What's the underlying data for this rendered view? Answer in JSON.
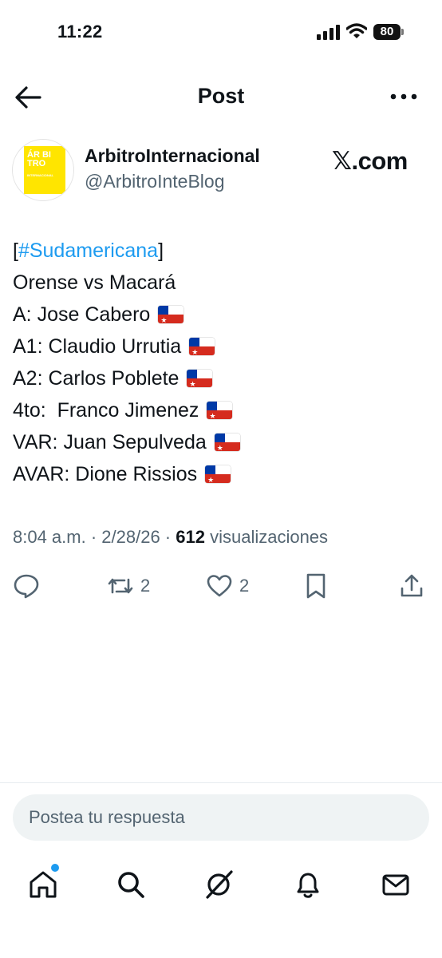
{
  "status_bar": {
    "time": "11:22",
    "battery": "80"
  },
  "header": {
    "title": "Post"
  },
  "author": {
    "display_name": "ArbitroInternacional",
    "handle": "@ArbitroInteBlog",
    "logo_text": "ÁR BI TRO",
    "logo_subtext": "INTERNACIONAL"
  },
  "source_badge": "𝕏.com",
  "tweet": {
    "bracket_open": "[",
    "hashtag": "#Sudamericana",
    "bracket_close": "]",
    "lines": [
      "Orense vs Macará",
      "A: Jose Cabero",
      "A1: Claudio Urrutia",
      "A2: Carlos Poblete",
      "4to:  Franco Jimenez",
      "VAR: Juan Sepulveda",
      "AVAR: Dione Rissios"
    ]
  },
  "meta": {
    "time": "8:04 a.m.",
    "sep1": " · ",
    "date": "2/28/26",
    "sep2": " · ",
    "views_count": "612",
    "views_label": " visualizaciones"
  },
  "actions": {
    "retweets": "2",
    "likes": "2"
  },
  "reply_placeholder": "Postea tu respuesta",
  "colors": {
    "accent": "#1d9bf0",
    "muted": "#536471",
    "text": "#0f1419"
  }
}
